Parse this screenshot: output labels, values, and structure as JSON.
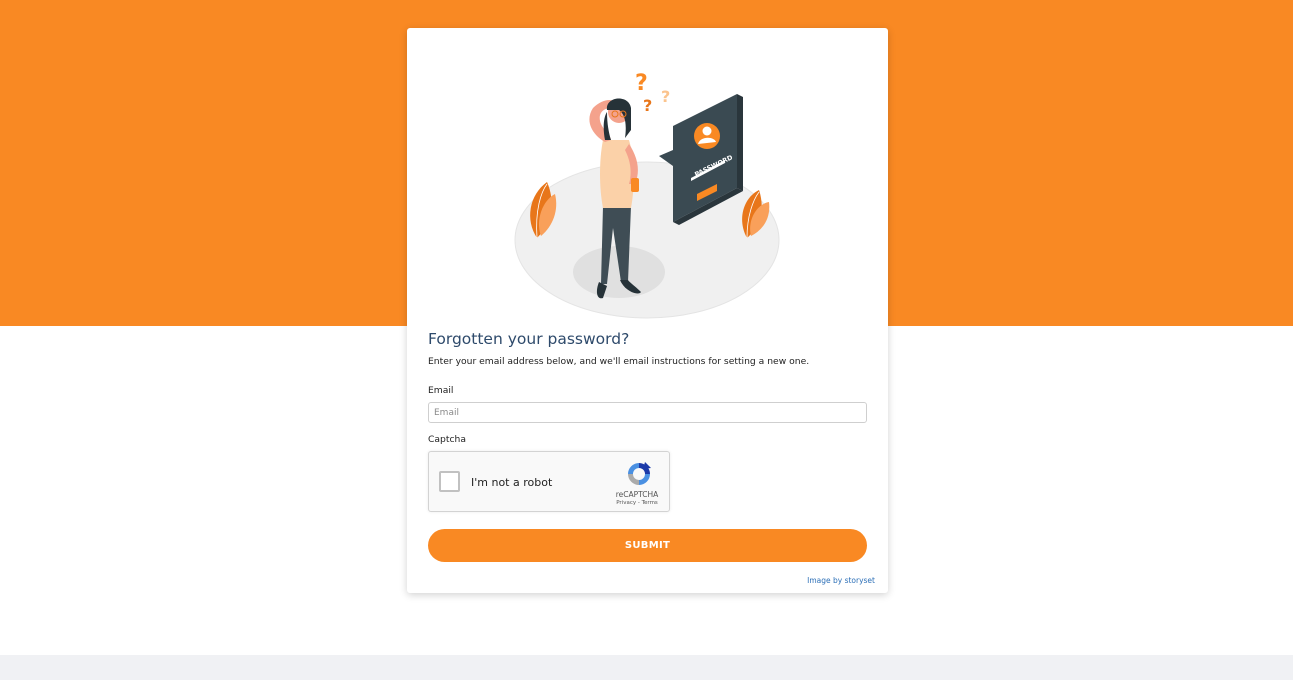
{
  "header": {
    "title": "Forgotten your password?",
    "subtitle": "Enter your email address below, and we'll email instructions for setting a new one."
  },
  "illustration": {
    "question_mark": "?",
    "card_text": "PASSWORD"
  },
  "form": {
    "email_label": "Email",
    "email_placeholder": "Email",
    "email_value": "",
    "captcha_label": "Captcha"
  },
  "recaptcha": {
    "label": "I'm not a robot",
    "brand": "reCAPTCHA",
    "privacy": "Privacy",
    "separator": " - ",
    "terms": "Terms"
  },
  "submit": {
    "label": "SUBMIT"
  },
  "credit": {
    "text": "Image by storyset"
  },
  "colors": {
    "brand_orange": "#f98923",
    "title_blue": "#2e4a6b",
    "link_blue": "#2c6fb7",
    "footer_gray": "#f0f1f4"
  }
}
